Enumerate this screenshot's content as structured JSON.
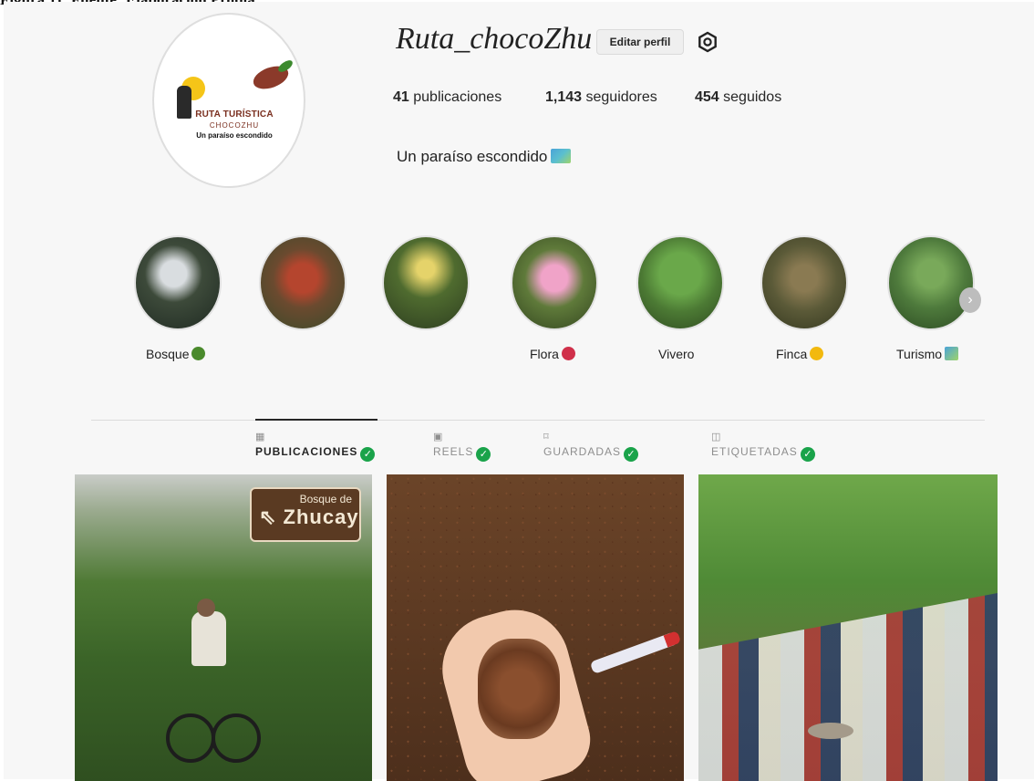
{
  "profile": {
    "username": "Ruta_chocoZhu",
    "edit_button": "Editar perfil",
    "settings_icon": "gear-icon",
    "logo": {
      "line1": "RUTA TURÍSTICA",
      "line2": "CHOCOZHU",
      "line3": "Un paraíso escondido"
    },
    "stats": {
      "posts": {
        "count": "41",
        "label": "publicaciones"
      },
      "followers": {
        "count": "1,143",
        "label": "seguidores"
      },
      "following": {
        "count": "454",
        "label": "seguidos"
      }
    },
    "bio": "Un paraíso escondido"
  },
  "highlights": [
    {
      "label": "Bosque",
      "emoji_icon": "tree-icon",
      "color": "#3d4a3a"
    },
    {
      "label": "",
      "emoji_icon": "",
      "color": "#6b4a2f"
    },
    {
      "label": "",
      "emoji_icon": "",
      "color": "#4f6b2f"
    },
    {
      "label": "Flora",
      "emoji_icon": "hibiscus-icon",
      "color": "#5f7a3a"
    },
    {
      "label": "Vivero",
      "emoji_icon": "",
      "color": "#4c7a34"
    },
    {
      "label": "Finca",
      "emoji_icon": "sun-icon",
      "color": "#5b5a38"
    },
    {
      "label": "Turismo",
      "emoji_icon": "map-icon",
      "color": "#4e7a3c"
    }
  ],
  "tabs": [
    {
      "label": "PUBLICACIONES",
      "icon": "grid-icon",
      "active": true
    },
    {
      "label": "REELS",
      "icon": "reels-icon",
      "active": false
    },
    {
      "label": "GUARDADAS",
      "icon": "bookmark-icon",
      "active": false
    },
    {
      "label": "ETIQUETADAS",
      "icon": "tag-icon",
      "active": false
    }
  ],
  "posts": [
    {
      "alt": "cyclist-photo",
      "sign_line1": "Bosque de",
      "sign_line2": "Zhucay"
    },
    {
      "alt": "cacao-beans-photo"
    },
    {
      "alt": "group-photo"
    }
  ],
  "colors": {
    "accent_check": "#1aa34a",
    "border": "#dbdbdb"
  }
}
